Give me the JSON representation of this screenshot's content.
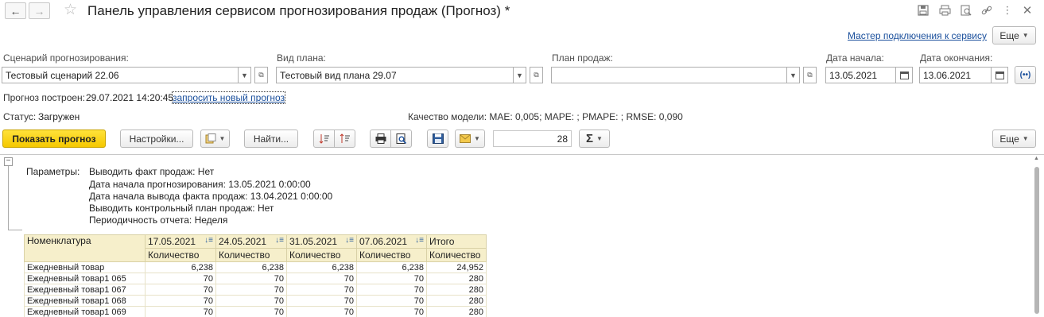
{
  "window": {
    "title": "Панель управления сервисом прогнозирования продаж (Прогноз) *"
  },
  "toplink": {
    "wizard": "Мастер подключения к сервису",
    "more_label": "Еще"
  },
  "form": {
    "scenario_label": "Сценарий прогнозирования:",
    "scenario_value": "Тестовый сценарий 22.06",
    "plan_type_label": "Вид плана:",
    "plan_type_value": "Тестовый вид плана 29.07",
    "sales_plan_label": "План продаж:",
    "sales_plan_value": "",
    "start_label": "Дата начала:",
    "start_value": "13.05.2021",
    "end_label": "Дата окончания:",
    "end_value": "13.06.2021"
  },
  "status": {
    "built_label": "Прогноз построен:",
    "built_value": "29.07.2021 14:20:45",
    "request_link": "запросить новый прогноз",
    "status_label": "Статус:",
    "status_value": "Загружен",
    "quality": "Качество модели: MAE: 0,005; MAPE: ; PMAPE: ; RMSE: 0,090"
  },
  "toolbar": {
    "show_forecast": "Показать прогноз",
    "settings": "Настройки...",
    "find": "Найти...",
    "sum_value": "28",
    "more_label": "Еще"
  },
  "report": {
    "params_label": "Параметры:",
    "params": [
      "Выводить факт продаж: Нет",
      "Дата начала прогнозирования: 13.05.2021 0:00:00",
      "Дата начала вывода факта продаж: 13.04.2021 0:00:00",
      "Выводить контрольный план продаж: Нет",
      "Периодичность отчета: Неделя"
    ],
    "table": {
      "first_header": "Номенклатура",
      "periods": [
        "17.05.2021",
        "24.05.2021",
        "31.05.2021",
        "07.06.2021"
      ],
      "total_header": "Итого",
      "sub_header": "Количество",
      "rows": [
        {
          "name": "Ежедневный товар",
          "values": [
            "6,238",
            "6,238",
            "6,238",
            "6,238",
            "24,952"
          ]
        },
        {
          "name": "Ежедневный товар1 065",
          "values": [
            "70",
            "70",
            "70",
            "70",
            "280"
          ]
        },
        {
          "name": "Ежедневный товар1 067",
          "values": [
            "70",
            "70",
            "70",
            "70",
            "280"
          ]
        },
        {
          "name": "Ежедневный товар1 068",
          "values": [
            "70",
            "70",
            "70",
            "70",
            "280"
          ]
        },
        {
          "name": "Ежедневный товар1 069",
          "values": [
            "70",
            "70",
            "70",
            "70",
            "280"
          ]
        }
      ]
    }
  }
}
